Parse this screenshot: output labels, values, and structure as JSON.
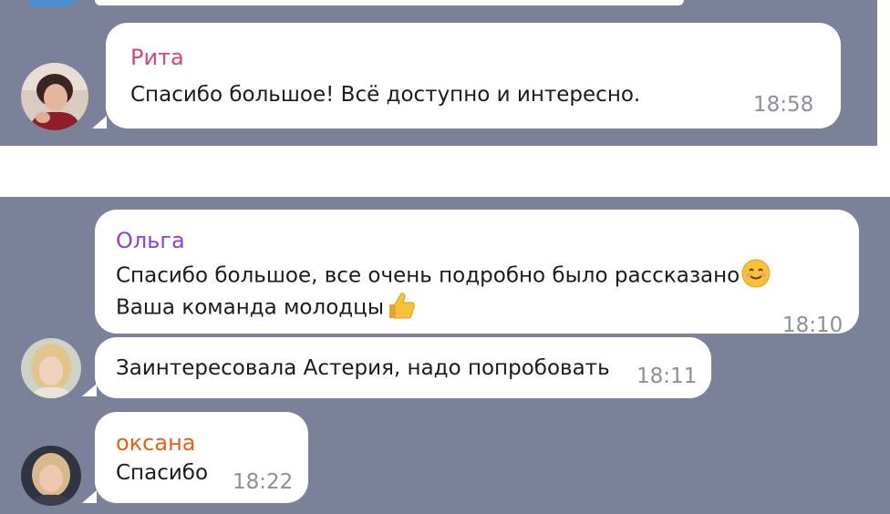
{
  "messages_top": [
    {
      "name": "Рита",
      "name_color": "#d1487a",
      "text": "Спасибо большое! Всё доступно и интересно.",
      "time": "18:58"
    }
  ],
  "messages_bottom": [
    {
      "name": "Ольга",
      "name_color": "#8a3fe0",
      "line1": "Спасибо большое, все очень подробно было рассказано",
      "emoji1": "smiling-face-emoji",
      "line2": "Ваша команда молодцы",
      "emoji2": "thumbs-up-emoji",
      "time": "18:10"
    },
    {
      "text": "Заинтересовала Астерия, надо попробовать",
      "time": "18:11"
    },
    {
      "name": "оксана",
      "name_color": "#d9641d",
      "text": "Спасибо",
      "time": "18:22"
    }
  ],
  "colors": {
    "chat_background": "#7a8199",
    "bubble": "#ffffff",
    "timestamp": "#8d8f99"
  }
}
